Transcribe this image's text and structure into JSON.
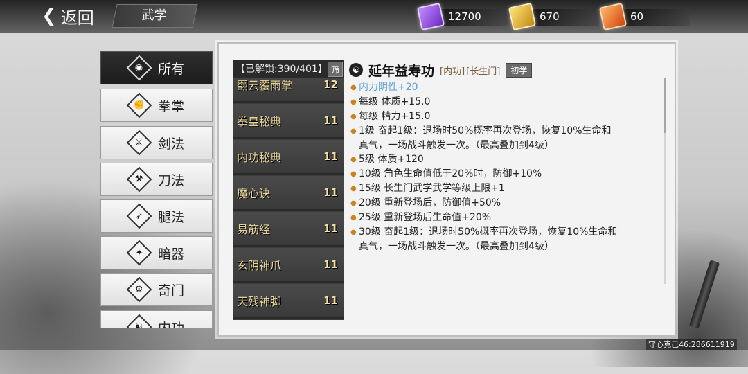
{
  "header": {
    "back_label": "返回",
    "title": "武学"
  },
  "resources": [
    {
      "icon": "purple-gem-icon",
      "value": "12700",
      "color": "#8b4fe0"
    },
    {
      "icon": "gold-scroll-icon",
      "value": "670",
      "color": "#e0b021"
    },
    {
      "icon": "orange-flame-icon",
      "value": "60",
      "color": "#e0681a"
    }
  ],
  "categories": [
    {
      "label": "所有",
      "icon": "all-icon",
      "glyph": "◉",
      "active": true
    },
    {
      "label": "拳掌",
      "icon": "fist-icon",
      "glyph": "✊"
    },
    {
      "label": "剑法",
      "icon": "sword-icon",
      "glyph": "⚔"
    },
    {
      "label": "刀法",
      "icon": "blade-icon",
      "glyph": "⚒"
    },
    {
      "label": "腿法",
      "icon": "leg-icon",
      "glyph": "➶"
    },
    {
      "label": "暗器",
      "icon": "hidden-weapon-icon",
      "glyph": "✦"
    },
    {
      "label": "奇门",
      "icon": "exotic-weapon-icon",
      "glyph": "⚙"
    },
    {
      "label": "内功",
      "icon": "inner-power-icon",
      "glyph": "☯"
    }
  ],
  "skill_list": {
    "unlocked_label": "【已解锁:390/401】",
    "filter_label": "筛",
    "items": [
      {
        "name": "翻云覆雨掌",
        "level": "12"
      },
      {
        "name": "拳皇秘典",
        "level": "11"
      },
      {
        "name": "内功秘典",
        "level": "11"
      },
      {
        "name": "魔心诀",
        "level": "11"
      },
      {
        "name": "易筋经",
        "level": "11"
      },
      {
        "name": "玄阴神爪",
        "level": "11"
      },
      {
        "name": "天残神脚",
        "level": "11"
      }
    ]
  },
  "detail": {
    "name": "延年益寿功",
    "type_tag": "[内功]",
    "school_tag": "[长生门]",
    "rank": "初学",
    "stats": [
      {
        "text": "内力阴性+20",
        "highlight": true
      },
      {
        "text": "每级  体质+15.0"
      },
      {
        "text": "每级  精力+15.0"
      },
      {
        "text": "1级   奋起1级：退场时50%概率再次登场，恢复10%生命和"
      },
      {
        "text": "真气，一场战斗触发一次。（最高叠加到4级）",
        "cont": true
      },
      {
        "text": "5级   体质+120"
      },
      {
        "text": "10级  角色生命值低于20%时，防御+10%"
      },
      {
        "text": "15级  长生门武学武学等级上限+1"
      },
      {
        "text": "20级  重新登场后，防御值+50%"
      },
      {
        "text": "25级  重新登场后生命值+20%"
      },
      {
        "text": "30级  奋起1级：退场时50%概率再次登场，恢复10%生命和"
      },
      {
        "text": "真气，一场战斗触发一次。（最高叠加到4级）",
        "cont": true
      }
    ]
  },
  "footer": {
    "player_id": "守心克己46:286611919"
  }
}
